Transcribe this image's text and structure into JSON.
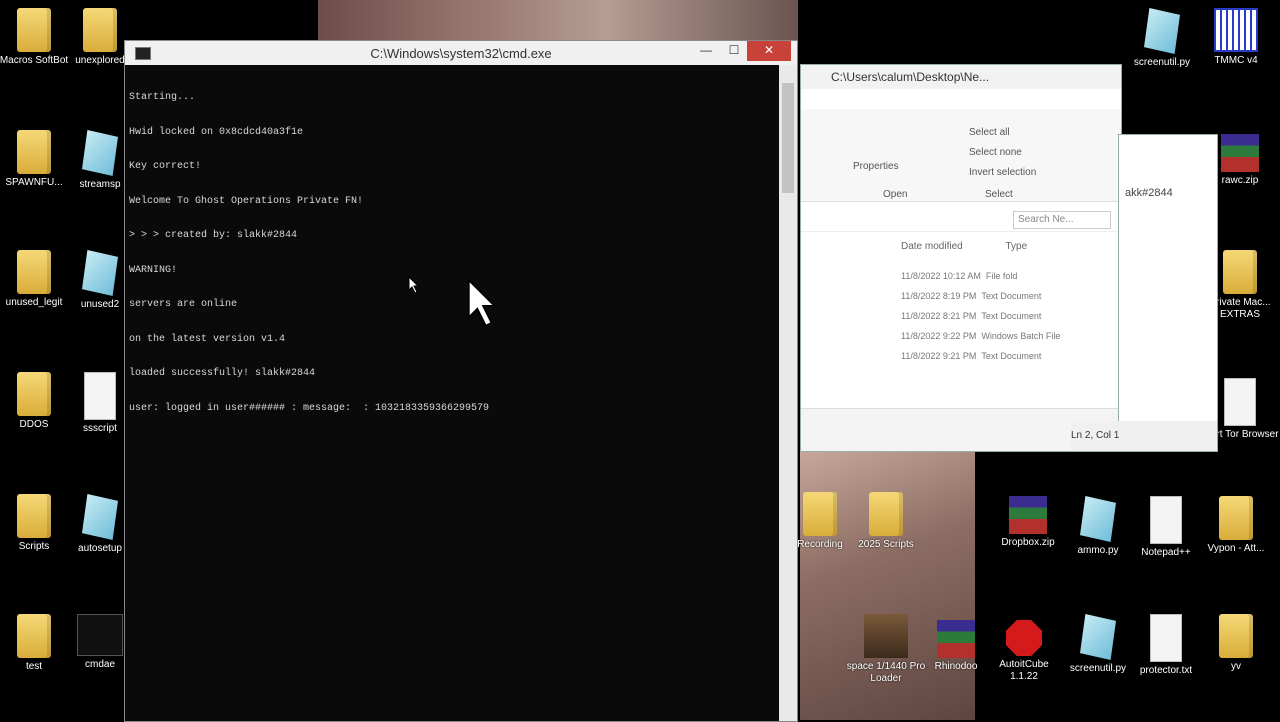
{
  "cmd": {
    "title": "C:\\Windows\\system32\\cmd.exe",
    "lines": [
      "Starting...",
      "Hwid locked on 0x8cdcd40a3f1e",
      "Key correct!",
      "Welcome To Ghost Operations Private FN!",
      "> > > created by: slakk#2844",
      "WARNING!",
      "servers are online",
      "on the latest version v1.4",
      "loaded successfully! slakk#2844",
      "user: logged in user###### : message:  : 1032183359366299579"
    ],
    "minimize": "—",
    "maximize": "☐",
    "close": "✕"
  },
  "explorer": {
    "title": "C:\\Users\\calum\\Desktop\\Ne...",
    "ribbon": {
      "select_all": "Select all",
      "select_none": "Select none",
      "invert_selection": "Invert selection",
      "properties": "Properties",
      "open_group": "Open",
      "select_group": "Select"
    },
    "search_placeholder": "Search Ne...",
    "columns": {
      "date": "Date modified",
      "type": "Type"
    },
    "rows": [
      {
        "date": "11/8/2022 10:12 AM",
        "type": "File fold"
      },
      {
        "date": "11/8/2022 8:19 PM",
        "type": "Text Document"
      },
      {
        "date": "11/8/2022 8:21 PM",
        "type": "Text Document"
      },
      {
        "date": "11/8/2022 9:22 PM",
        "type": "Windows Batch File"
      },
      {
        "date": "11/8/2022 9:21 PM",
        "type": "Text Document"
      }
    ]
  },
  "notepad": {
    "text": "akk#2844",
    "status": "Ln 2, Col 1"
  },
  "desktop_icons": [
    {
      "label": "Macros SoftBot",
      "icon": "folder-icon"
    },
    {
      "label": "unexplored",
      "icon": "folder-icon"
    },
    {
      "label": "SPAWNFU...",
      "icon": "folder-icon"
    },
    {
      "label": "streamsp",
      "icon": "py-file-icon"
    },
    {
      "label": "unused_legit",
      "icon": "folder-icon"
    },
    {
      "label": "unused2",
      "icon": "py-file-icon"
    },
    {
      "label": "DDOS",
      "icon": "folder-icon"
    },
    {
      "label": "ssscript",
      "icon": "script-icon"
    },
    {
      "label": "Scripts",
      "icon": "folder-icon"
    },
    {
      "label": "autosetup",
      "icon": "py-file-icon"
    },
    {
      "label": "test",
      "icon": "folder-icon"
    },
    {
      "label": "cmdae",
      "icon": "cmd-icon"
    },
    {
      "label": "screenutil.py",
      "icon": "py-file-icon"
    },
    {
      "label": "TMMC v4",
      "icon": "maze-icon"
    },
    {
      "label": "rawc.zip",
      "icon": "rar-icon"
    },
    {
      "label": "Private Mac... EXTRAS",
      "icon": "folder-icon"
    },
    {
      "label": "Start Tor Browser",
      "icon": "doc-icon"
    },
    {
      "label": "Dropbox.zip",
      "icon": "rar-icon"
    },
    {
      "label": "ammo.py",
      "icon": "py-file-icon"
    },
    {
      "label": "Notepad++",
      "icon": "notepad-icon"
    },
    {
      "label": "Vypon - Att...",
      "icon": "folder-icon"
    },
    {
      "label": "Recording",
      "icon": "folder-icon"
    },
    {
      "label": "2025 Scripts",
      "icon": "folder-icon"
    },
    {
      "label": "screenutil.py",
      "icon": "py-file-icon"
    },
    {
      "label": "protector.txt",
      "icon": "search-doc-icon"
    },
    {
      "label": "yv",
      "icon": "folder-icon"
    },
    {
      "label": "AutoitCube 1.1.22",
      "icon": "red-octagon-icon"
    },
    {
      "label": "space 1/1440 Pro Loader",
      "icon": "photo-icon"
    },
    {
      "label": "Rhinodoo",
      "icon": "rar-icon"
    }
  ]
}
